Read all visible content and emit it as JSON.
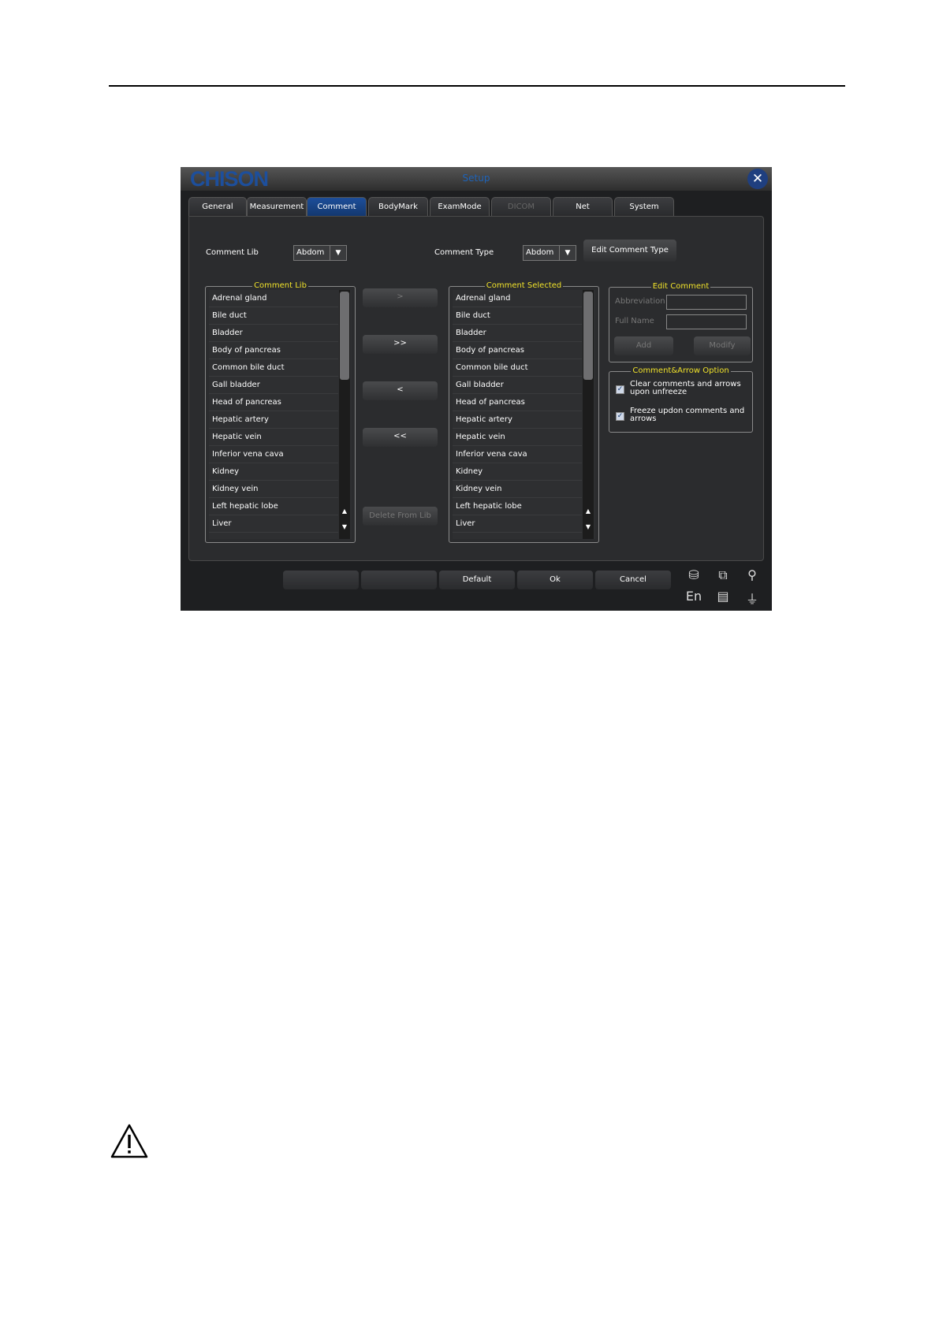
{
  "window": {
    "brand": "CHISON",
    "title": "Setup",
    "close_icon": "close-icon"
  },
  "tabs": [
    {
      "label": "General"
    },
    {
      "label": "Measurement"
    },
    {
      "label": "Comment"
    },
    {
      "label": "BodyMark"
    },
    {
      "label": "ExamMode"
    },
    {
      "label": "DICOM"
    },
    {
      "label": "Net"
    },
    {
      "label": "System"
    }
  ],
  "top": {
    "comment_lib_label": "Comment Lib",
    "comment_lib_value": "Abdom",
    "comment_type_label": "Comment Type",
    "comment_type_value": "Abdom",
    "edit_type_button": "Edit Comment Type"
  },
  "comment_lib": {
    "legend": "Comment Lib",
    "items": [
      "Adrenal gland",
      "Bile duct",
      "Bladder",
      "Body of pancreas",
      "Common bile duct",
      "Gall bladder",
      "Head of pancreas",
      "Hepatic artery",
      "Hepatic vein",
      "Inferior vena cava",
      "Kidney",
      "Kidney vein",
      "Left hepatic lobe",
      "Liver"
    ]
  },
  "comment_selected": {
    "legend": "Comment Selected",
    "items": [
      "Adrenal gland",
      "Bile duct",
      "Bladder",
      "Body of pancreas",
      "Common bile duct",
      "Gall bladder",
      "Head of pancreas",
      "Hepatic artery",
      "Hepatic vein",
      "Inferior vena cava",
      "Kidney",
      "Kidney vein",
      "Left hepatic lobe",
      "Liver"
    ]
  },
  "transfer": {
    "add_one": ">",
    "add_all": ">>",
    "remove_one": "<",
    "remove_all": "<<",
    "delete_from_lib": "Delete From Lib"
  },
  "edit_comment": {
    "legend": "Edit Comment",
    "abbreviation_label": "Abbreviation",
    "full_name_label": "Full Name",
    "abbreviation_value": "",
    "full_name_value": "",
    "add_button": "Add",
    "modify_button": "Modify"
  },
  "options": {
    "legend": "Comment&Arrow Option",
    "clear_label": "Clear comments and arrows upon unfreeze",
    "clear_checked": true,
    "freeze_label": "Freeze updon comments and arrows",
    "freeze_checked": true
  },
  "footer": {
    "blank1": "",
    "blank2": "",
    "default_button": "Default",
    "ok_button": "Ok",
    "cancel_button": "Cancel",
    "language": "En",
    "icons": [
      "database-icon",
      "network-icon",
      "usb-icon",
      "disk-icon",
      "plug-icon"
    ]
  }
}
